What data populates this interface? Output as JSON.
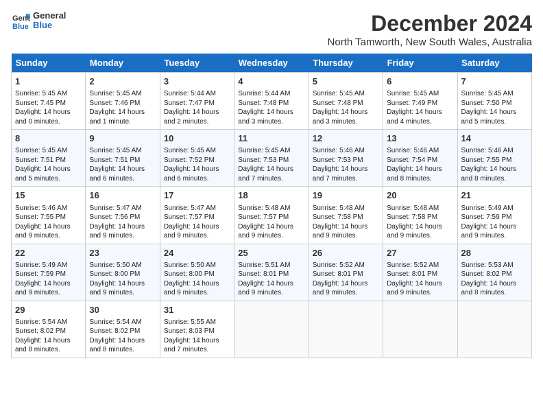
{
  "logo": {
    "line1": "General",
    "line2": "Blue"
  },
  "title": "December 2024",
  "location": "North Tamworth, New South Wales, Australia",
  "days_of_week": [
    "Sunday",
    "Monday",
    "Tuesday",
    "Wednesday",
    "Thursday",
    "Friday",
    "Saturday"
  ],
  "weeks": [
    [
      {
        "day": "1",
        "info": "Sunrise: 5:45 AM\nSunset: 7:45 PM\nDaylight: 14 hours\nand 0 minutes."
      },
      {
        "day": "2",
        "info": "Sunrise: 5:45 AM\nSunset: 7:46 PM\nDaylight: 14 hours\nand 1 minute."
      },
      {
        "day": "3",
        "info": "Sunrise: 5:44 AM\nSunset: 7:47 PM\nDaylight: 14 hours\nand 2 minutes."
      },
      {
        "day": "4",
        "info": "Sunrise: 5:44 AM\nSunset: 7:48 PM\nDaylight: 14 hours\nand 3 minutes."
      },
      {
        "day": "5",
        "info": "Sunrise: 5:45 AM\nSunset: 7:48 PM\nDaylight: 14 hours\nand 3 minutes."
      },
      {
        "day": "6",
        "info": "Sunrise: 5:45 AM\nSunset: 7:49 PM\nDaylight: 14 hours\nand 4 minutes."
      },
      {
        "day": "7",
        "info": "Sunrise: 5:45 AM\nSunset: 7:50 PM\nDaylight: 14 hours\nand 5 minutes."
      }
    ],
    [
      {
        "day": "8",
        "info": "Sunrise: 5:45 AM\nSunset: 7:51 PM\nDaylight: 14 hours\nand 5 minutes."
      },
      {
        "day": "9",
        "info": "Sunrise: 5:45 AM\nSunset: 7:51 PM\nDaylight: 14 hours\nand 6 minutes."
      },
      {
        "day": "10",
        "info": "Sunrise: 5:45 AM\nSunset: 7:52 PM\nDaylight: 14 hours\nand 6 minutes."
      },
      {
        "day": "11",
        "info": "Sunrise: 5:45 AM\nSunset: 7:53 PM\nDaylight: 14 hours\nand 7 minutes."
      },
      {
        "day": "12",
        "info": "Sunrise: 5:46 AM\nSunset: 7:53 PM\nDaylight: 14 hours\nand 7 minutes."
      },
      {
        "day": "13",
        "info": "Sunrise: 5:46 AM\nSunset: 7:54 PM\nDaylight: 14 hours\nand 8 minutes."
      },
      {
        "day": "14",
        "info": "Sunrise: 5:46 AM\nSunset: 7:55 PM\nDaylight: 14 hours\nand 8 minutes."
      }
    ],
    [
      {
        "day": "15",
        "info": "Sunrise: 5:46 AM\nSunset: 7:55 PM\nDaylight: 14 hours\nand 9 minutes."
      },
      {
        "day": "16",
        "info": "Sunrise: 5:47 AM\nSunset: 7:56 PM\nDaylight: 14 hours\nand 9 minutes."
      },
      {
        "day": "17",
        "info": "Sunrise: 5:47 AM\nSunset: 7:57 PM\nDaylight: 14 hours\nand 9 minutes."
      },
      {
        "day": "18",
        "info": "Sunrise: 5:48 AM\nSunset: 7:57 PM\nDaylight: 14 hours\nand 9 minutes."
      },
      {
        "day": "19",
        "info": "Sunrise: 5:48 AM\nSunset: 7:58 PM\nDaylight: 14 hours\nand 9 minutes."
      },
      {
        "day": "20",
        "info": "Sunrise: 5:48 AM\nSunset: 7:58 PM\nDaylight: 14 hours\nand 9 minutes."
      },
      {
        "day": "21",
        "info": "Sunrise: 5:49 AM\nSunset: 7:59 PM\nDaylight: 14 hours\nand 9 minutes."
      }
    ],
    [
      {
        "day": "22",
        "info": "Sunrise: 5:49 AM\nSunset: 7:59 PM\nDaylight: 14 hours\nand 9 minutes."
      },
      {
        "day": "23",
        "info": "Sunrise: 5:50 AM\nSunset: 8:00 PM\nDaylight: 14 hours\nand 9 minutes."
      },
      {
        "day": "24",
        "info": "Sunrise: 5:50 AM\nSunset: 8:00 PM\nDaylight: 14 hours\nand 9 minutes."
      },
      {
        "day": "25",
        "info": "Sunrise: 5:51 AM\nSunset: 8:01 PM\nDaylight: 14 hours\nand 9 minutes."
      },
      {
        "day": "26",
        "info": "Sunrise: 5:52 AM\nSunset: 8:01 PM\nDaylight: 14 hours\nand 9 minutes."
      },
      {
        "day": "27",
        "info": "Sunrise: 5:52 AM\nSunset: 8:01 PM\nDaylight: 14 hours\nand 9 minutes."
      },
      {
        "day": "28",
        "info": "Sunrise: 5:53 AM\nSunset: 8:02 PM\nDaylight: 14 hours\nand 8 minutes."
      }
    ],
    [
      {
        "day": "29",
        "info": "Sunrise: 5:54 AM\nSunset: 8:02 PM\nDaylight: 14 hours\nand 8 minutes."
      },
      {
        "day": "30",
        "info": "Sunrise: 5:54 AM\nSunset: 8:02 PM\nDaylight: 14 hours\nand 8 minutes."
      },
      {
        "day": "31",
        "info": "Sunrise: 5:55 AM\nSunset: 8:03 PM\nDaylight: 14 hours\nand 7 minutes."
      },
      null,
      null,
      null,
      null
    ]
  ]
}
